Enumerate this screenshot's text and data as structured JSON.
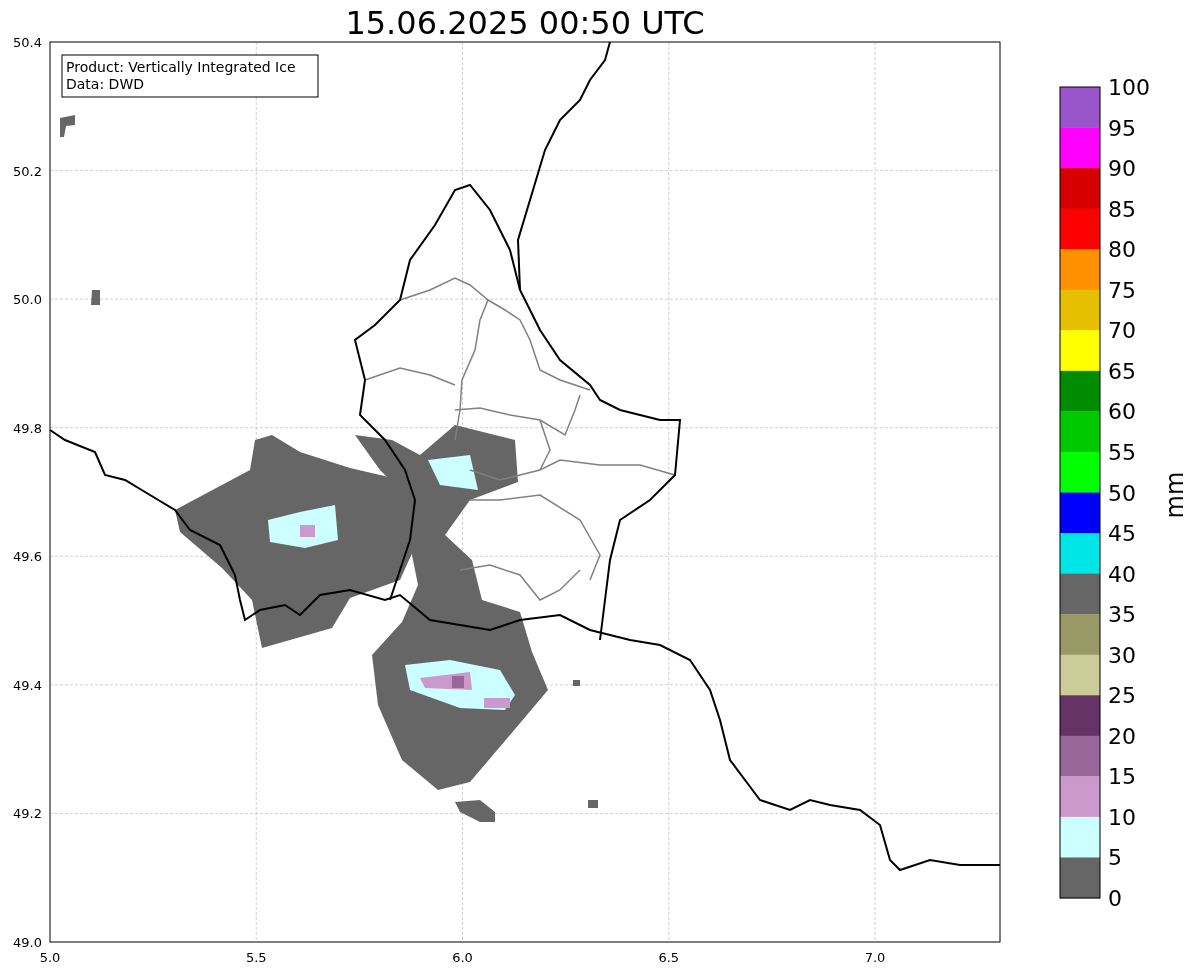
{
  "title": "15.06.2025 00:50 UTC",
  "info_box": {
    "lines": [
      "Product: Vertically Integrated Ice",
      "Data: DWD"
    ]
  },
  "map": {
    "x_ticks": [
      "5.0",
      "5.5",
      "6.0",
      "6.5",
      "7.0"
    ],
    "y_ticks": [
      "50.4",
      "50.2",
      "50.0",
      "49.8",
      "49.6",
      "49.4",
      "49.2",
      "49.0"
    ]
  },
  "colorbar": {
    "label": "mm",
    "ticks": [
      "100",
      "95",
      "90",
      "85",
      "80",
      "75",
      "70",
      "65",
      "60",
      "55",
      "50",
      "45",
      "40",
      "35",
      "30",
      "25",
      "20",
      "15",
      "10",
      "5",
      "0"
    ],
    "bins": [
      {
        "color": "#9955c9"
      },
      {
        "color": "#ff00ff"
      },
      {
        "color": "#d60000"
      },
      {
        "color": "#ff0000"
      },
      {
        "color": "#ff9000"
      },
      {
        "color": "#e5bf00"
      },
      {
        "color": "#ffff00"
      },
      {
        "color": "#008c00"
      },
      {
        "color": "#00c800"
      },
      {
        "color": "#00ff00"
      },
      {
        "color": "#0000ff"
      },
      {
        "color": "#00e5e5"
      },
      {
        "color": "#666666"
      },
      {
        "color": "#999966"
      },
      {
        "color": "#cccc99"
      },
      {
        "color": "#663366"
      },
      {
        "color": "#996699"
      },
      {
        "color": "#cc99cc"
      },
      {
        "color": "#ccffff"
      },
      {
        "color": "#666666"
      }
    ]
  }
}
